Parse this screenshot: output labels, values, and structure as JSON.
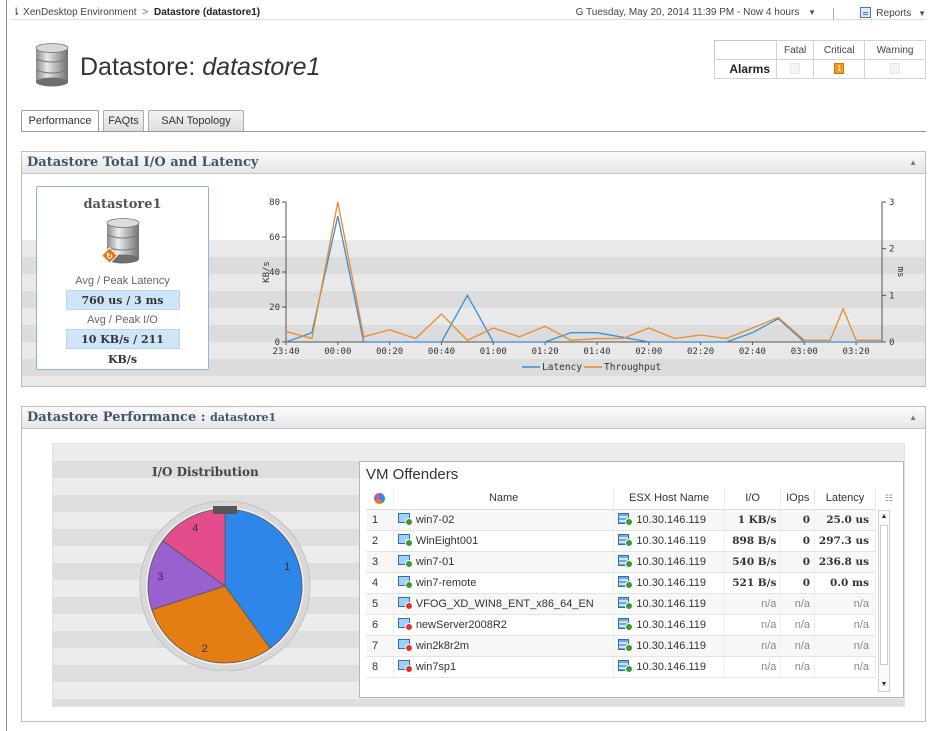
{
  "breadcrumb": {
    "root": "XenDesktop Environment",
    "separator": ">",
    "current": "Datastore (datastore1)"
  },
  "time_range": "Tuesday, May 20, 2014 11:39 PM - Now 4 hours",
  "reports_label": "Reports",
  "page_title": {
    "prefix": "Datastore: ",
    "name": "datastore1"
  },
  "alarms": {
    "label": "Alarms",
    "columns": [
      "Fatal",
      "Critical",
      "Warning"
    ],
    "counts": [
      "",
      "1",
      ""
    ]
  },
  "tabs": [
    {
      "label": "Performance",
      "active": true
    },
    {
      "label": "FAQts",
      "active": false
    },
    {
      "label": "SAN Topology",
      "active": false
    }
  ],
  "panel1": {
    "title": "Datastore Total I/O and Latency",
    "card": {
      "title": "datastore1",
      "latency_label": "Avg / Peak Latency",
      "latency_value": "760 us / 3 ms",
      "io_label": "Avg / Peak I/O",
      "io_value": "10 KB/s / 211 KB/s"
    }
  },
  "chart_data": {
    "type": "line",
    "x": [
      "23:40",
      "23:50",
      "00:00",
      "00:10",
      "00:20",
      "00:30",
      "00:40",
      "00:50",
      "01:00",
      "01:10",
      "01:20",
      "01:30",
      "01:40",
      "01:50",
      "02:00",
      "02:10",
      "02:20",
      "02:30",
      "02:40",
      "02:50",
      "03:00",
      "03:10",
      "03:15",
      "03:20",
      "03:25",
      "03:30"
    ],
    "x_ticks": [
      "23:40",
      "00:00",
      "00:20",
      "00:40",
      "01:00",
      "01:20",
      "01:40",
      "02:00",
      "02:20",
      "02:40",
      "03:00",
      "03:20"
    ],
    "series": [
      {
        "name": "Latency",
        "color": "#3a8fd8",
        "axis": "right",
        "values": [
          0,
          0.2,
          2.7,
          0,
          0,
          0,
          0,
          1,
          0,
          0,
          0,
          0.2,
          0.2,
          0.1,
          0,
          0,
          0,
          0,
          0.2,
          0.5,
          0,
          0,
          0,
          0,
          0,
          0
        ]
      },
      {
        "name": "Throughput",
        "color": "#e88a2d",
        "axis": "left",
        "values": [
          6,
          2,
          80,
          3,
          7,
          2,
          16,
          1,
          8,
          3,
          9,
          1,
          2,
          2,
          8,
          2,
          4,
          2,
          8,
          14,
          1,
          1,
          19,
          1,
          1,
          1
        ]
      }
    ],
    "ylabel_left": "KB/s",
    "ylim_left": [
      0,
      80
    ],
    "yticks_left": [
      0,
      20,
      40,
      60,
      80
    ],
    "ylabel_right": "ms",
    "ylim_right": [
      0,
      3
    ],
    "yticks_right": [
      0,
      1,
      2,
      3
    ],
    "legend": "bottom"
  },
  "panel2": {
    "title": "Datastore Performance : ",
    "title_small": "datastore1",
    "io_distribution_title": "I/O Distribution",
    "pie": [
      {
        "label": "1",
        "value": 40,
        "color": "#2f86ea"
      },
      {
        "label": "2",
        "value": 30,
        "color": "#e57e12"
      },
      {
        "label": "3",
        "value": 15,
        "color": "#9960cf"
      },
      {
        "label": "4",
        "value": 15,
        "color": "#e44d8d"
      }
    ],
    "vm_offenders": {
      "title": "VM Offenders",
      "columns": [
        "Name",
        "ESX Host Name",
        "I/O",
        "IOps",
        "Latency"
      ],
      "rows": [
        {
          "num": "1",
          "name": "win7-02",
          "host": "10.30.146.119",
          "io": "1 KB/s",
          "iops": "0",
          "latency": "25.0 us",
          "status": "ok"
        },
        {
          "num": "2",
          "name": "WinEight001",
          "host": "10.30.146.119",
          "io": "898 B/s",
          "iops": "0",
          "latency": "297.3 us",
          "status": "ok"
        },
        {
          "num": "3",
          "name": "win7-01",
          "host": "10.30.146.119",
          "io": "540 B/s",
          "iops": "0",
          "latency": "236.8 us",
          "status": "ok"
        },
        {
          "num": "4",
          "name": "win7-remote",
          "host": "10.30.146.119",
          "io": "521 B/s",
          "iops": "0",
          "latency": "0.0 ms",
          "status": "ok"
        },
        {
          "num": "5",
          "name": "VFOG_XD_WIN8_ENT_x86_64_EN",
          "host": "10.30.146.119",
          "io": "n/a",
          "iops": "n/a",
          "latency": "n/a",
          "status": "err"
        },
        {
          "num": "6",
          "name": "newServer2008R2",
          "host": "10.30.146.119",
          "io": "n/a",
          "iops": "n/a",
          "latency": "n/a",
          "status": "err"
        },
        {
          "num": "7",
          "name": "win2k8r2m",
          "host": "10.30.146.119",
          "io": "n/a",
          "iops": "n/a",
          "latency": "n/a",
          "status": "err"
        },
        {
          "num": "8",
          "name": "win7sp1",
          "host": "10.30.146.119",
          "io": "n/a",
          "iops": "n/a",
          "latency": "n/a",
          "status": "err"
        }
      ]
    }
  }
}
